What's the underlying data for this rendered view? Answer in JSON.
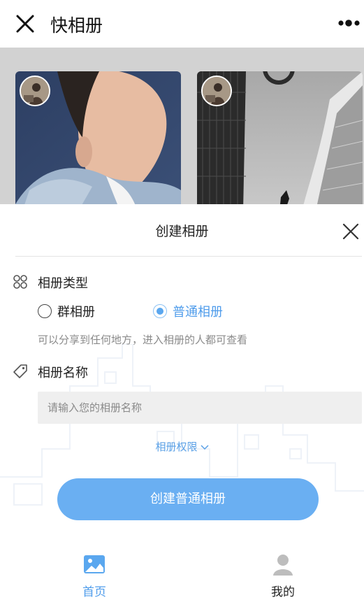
{
  "header": {
    "title": "快相册",
    "close_icon": "close-icon",
    "more_icon": "more-icon"
  },
  "sheet": {
    "title": "创建相册",
    "album_type": {
      "label": "相册类型",
      "icon": "grid-icon",
      "options": [
        {
          "label": "群相册",
          "selected": false
        },
        {
          "label": "普通相册",
          "selected": true
        }
      ],
      "hint": "可以分享到任何地方，进入相册的人都可查看"
    },
    "album_name": {
      "label": "相册名称",
      "icon": "tag-icon",
      "value": "",
      "placeholder": "请输入您的相册名称"
    },
    "permission_link": "相册权限",
    "create_button": "创建普通相册"
  },
  "tabbar": {
    "items": [
      {
        "label": "首页",
        "icon": "image-icon",
        "active": true
      },
      {
        "label": "我的",
        "icon": "user-icon",
        "active": false
      }
    ]
  },
  "colors": {
    "accent": "#4f9ceb",
    "button": "#6aaff2",
    "input_bg": "#efefef",
    "overlay": "#d2d2d2"
  }
}
